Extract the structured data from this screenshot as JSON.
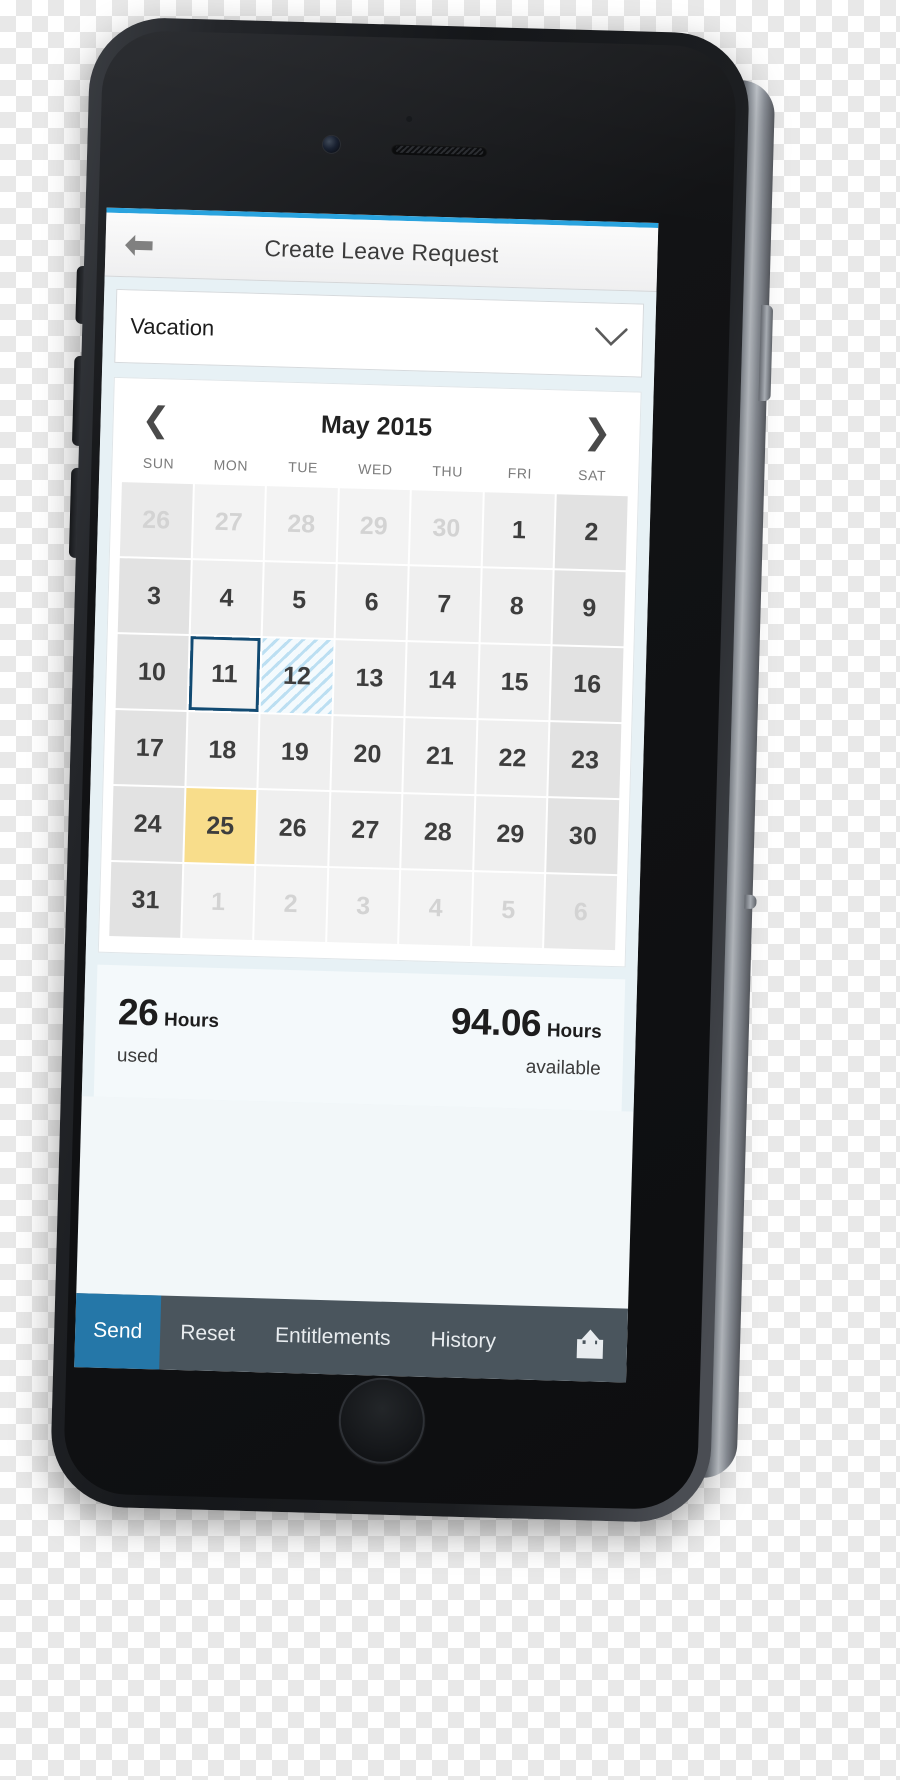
{
  "app": {
    "title": "Create Leave Request",
    "back_icon": "arrow-left-icon",
    "accent_color": "#2aa3de"
  },
  "leave_type": {
    "value": "Vacation",
    "dropdown_icon": "chevron-down-icon"
  },
  "calendar": {
    "month_label": "May 2015",
    "prev_icon": "❮",
    "next_icon": "❯",
    "weekdays": [
      "SUN",
      "MON",
      "TUE",
      "WED",
      "THU",
      "FRI",
      "SAT"
    ],
    "today_color": "#114a72",
    "selected_color": "#f8dd8b",
    "hatch_color": "#bcdff2",
    "weeks": [
      [
        {
          "label": "26",
          "state": "other",
          "weekend": true
        },
        {
          "label": "27",
          "state": "other",
          "weekend": false
        },
        {
          "label": "28",
          "state": "other",
          "weekend": false
        },
        {
          "label": "29",
          "state": "other",
          "weekend": false
        },
        {
          "label": "30",
          "state": "other",
          "weekend": false
        },
        {
          "label": "1",
          "state": "normal",
          "weekend": false
        },
        {
          "label": "2",
          "state": "normal",
          "weekend": true
        }
      ],
      [
        {
          "label": "3",
          "state": "normal",
          "weekend": true
        },
        {
          "label": "4",
          "state": "normal",
          "weekend": false
        },
        {
          "label": "5",
          "state": "normal",
          "weekend": false
        },
        {
          "label": "6",
          "state": "normal",
          "weekend": false
        },
        {
          "label": "7",
          "state": "normal",
          "weekend": false
        },
        {
          "label": "8",
          "state": "normal",
          "weekend": false
        },
        {
          "label": "9",
          "state": "normal",
          "weekend": true
        }
      ],
      [
        {
          "label": "10",
          "state": "normal",
          "weekend": true
        },
        {
          "label": "11",
          "state": "today",
          "weekend": false
        },
        {
          "label": "12",
          "state": "hatched",
          "weekend": false
        },
        {
          "label": "13",
          "state": "normal",
          "weekend": false
        },
        {
          "label": "14",
          "state": "normal",
          "weekend": false
        },
        {
          "label": "15",
          "state": "normal",
          "weekend": false
        },
        {
          "label": "16",
          "state": "normal",
          "weekend": true
        }
      ],
      [
        {
          "label": "17",
          "state": "normal",
          "weekend": true
        },
        {
          "label": "18",
          "state": "normal",
          "weekend": false
        },
        {
          "label": "19",
          "state": "normal",
          "weekend": false
        },
        {
          "label": "20",
          "state": "normal",
          "weekend": false
        },
        {
          "label": "21",
          "state": "normal",
          "weekend": false
        },
        {
          "label": "22",
          "state": "normal",
          "weekend": false
        },
        {
          "label": "23",
          "state": "normal",
          "weekend": true
        }
      ],
      [
        {
          "label": "24",
          "state": "normal",
          "weekend": true
        },
        {
          "label": "25",
          "state": "highlight",
          "weekend": false
        },
        {
          "label": "26",
          "state": "normal",
          "weekend": false
        },
        {
          "label": "27",
          "state": "normal",
          "weekend": false
        },
        {
          "label": "28",
          "state": "normal",
          "weekend": false
        },
        {
          "label": "29",
          "state": "normal",
          "weekend": false
        },
        {
          "label": "30",
          "state": "normal",
          "weekend": true
        }
      ],
      [
        {
          "label": "31",
          "state": "normal",
          "weekend": true
        },
        {
          "label": "1",
          "state": "other",
          "weekend": false
        },
        {
          "label": "2",
          "state": "other",
          "weekend": false
        },
        {
          "label": "3",
          "state": "other",
          "weekend": false
        },
        {
          "label": "4",
          "state": "other",
          "weekend": false
        },
        {
          "label": "5",
          "state": "other",
          "weekend": false
        },
        {
          "label": "6",
          "state": "other",
          "weekend": true
        }
      ]
    ]
  },
  "summary": {
    "used": {
      "number": "26",
      "unit": "Hours",
      "caption": "used"
    },
    "available": {
      "number": "94.06",
      "unit": "Hours",
      "caption": "available"
    }
  },
  "toolbar": {
    "send_label": "Send",
    "reset_label": "Reset",
    "entitlements_label": "Entitlements",
    "history_label": "History",
    "share_icon": "share-icon",
    "primary_color": "#2577a8",
    "bar_color": "#4a555d"
  }
}
